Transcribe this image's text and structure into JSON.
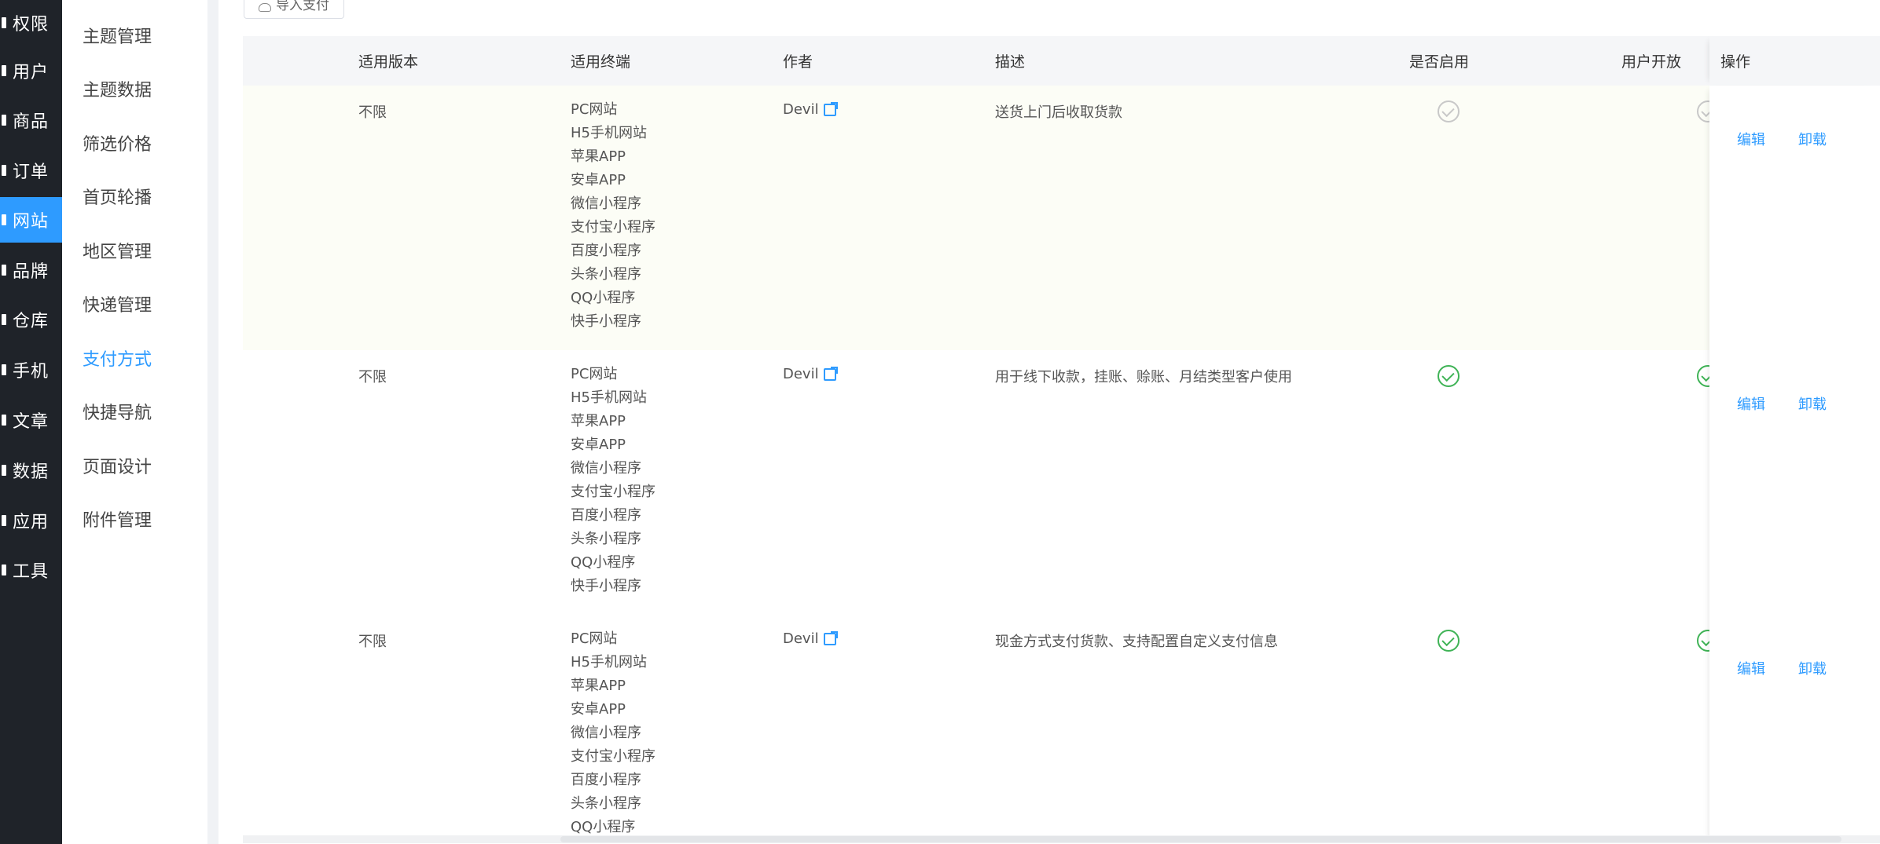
{
  "nav": {
    "items": [
      {
        "label": "权限"
      },
      {
        "label": "用户"
      },
      {
        "label": "商品"
      },
      {
        "label": "订单"
      },
      {
        "label": "网站",
        "active": true
      },
      {
        "label": "品牌"
      },
      {
        "label": "仓库"
      },
      {
        "label": "手机"
      },
      {
        "label": "文章"
      },
      {
        "label": "数据"
      },
      {
        "label": "应用"
      },
      {
        "label": "工具"
      }
    ]
  },
  "subnav": {
    "items": [
      {
        "label": "主题管理"
      },
      {
        "label": "主题数据"
      },
      {
        "label": "筛选价格"
      },
      {
        "label": "首页轮播"
      },
      {
        "label": "地区管理"
      },
      {
        "label": "快递管理"
      },
      {
        "label": "支付方式",
        "active": true
      },
      {
        "label": "快捷导航"
      },
      {
        "label": "页面设计"
      },
      {
        "label": "附件管理"
      }
    ]
  },
  "toolbar": {
    "import_label": "导入支付"
  },
  "table": {
    "headers": {
      "version": "适用版本",
      "terminals": "适用终端",
      "author": "作者",
      "description": "描述",
      "enabled": "是否启用",
      "user_open": "用户开放",
      "actions": "操作"
    },
    "rows": [
      {
        "version": "不限",
        "terminals": [
          "PC网站",
          "H5手机网站",
          "苹果APP",
          "安卓APP",
          "微信小程序",
          "支付宝小程序",
          "百度小程序",
          "头条小程序",
          "QQ小程序",
          "快手小程序"
        ],
        "author": "Devil",
        "description": "送货上门后收取货款",
        "enabled": false,
        "user_open": false,
        "edit_label": "编辑",
        "uninstall_label": "卸载"
      },
      {
        "version": "不限",
        "terminals": [
          "PC网站",
          "H5手机网站",
          "苹果APP",
          "安卓APP",
          "微信小程序",
          "支付宝小程序",
          "百度小程序",
          "头条小程序",
          "QQ小程序",
          "快手小程序"
        ],
        "author": "Devil",
        "description": "用于线下收款，挂账、赊账、月结类型客户使用",
        "enabled": true,
        "user_open": true,
        "edit_label": "编辑",
        "uninstall_label": "卸载"
      },
      {
        "version": "不限",
        "terminals": [
          "PC网站",
          "H5手机网站",
          "苹果APP",
          "安卓APP",
          "微信小程序",
          "支付宝小程序",
          "百度小程序",
          "头条小程序",
          "QQ小程序"
        ],
        "author": "Devil",
        "description": "现金方式支付货款、支持配置自定义支付信息",
        "enabled": true,
        "user_open": true,
        "edit_label": "编辑",
        "uninstall_label": "卸载"
      }
    ]
  },
  "colors": {
    "accent": "#2e9bff",
    "nav_bg": "#1f2329",
    "check_on": "#3fb356",
    "check_off": "#c8c8c8"
  }
}
